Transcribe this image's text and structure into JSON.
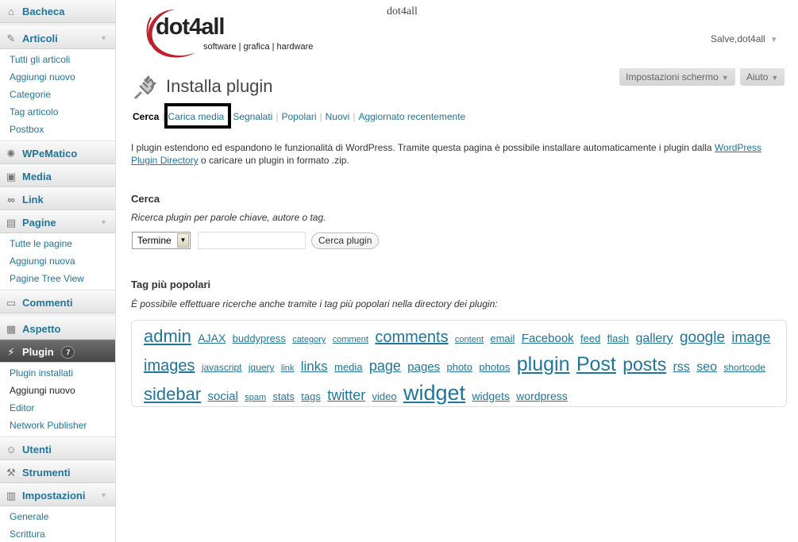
{
  "site": {
    "title": "dot4all",
    "logo_text": "dot4all",
    "logo_tagline": "software | grafica | hardware"
  },
  "header": {
    "howdy": "Salve,dot4all",
    "screen_options": "Impostazioni schermo",
    "help": "Aiuto"
  },
  "sidebar": {
    "dashboard": "Bacheca",
    "posts": {
      "label": "Articoli",
      "items": [
        "Tutti gli articoli",
        "Aggiungi nuovo",
        "Categorie",
        "Tag articolo",
        "Postbox"
      ]
    },
    "wpematico": "WPeMatico",
    "media": "Media",
    "links": "Link",
    "pages": {
      "label": "Pagine",
      "items": [
        "Tutte le pagine",
        "Aggiungi nuova",
        "Pagine Tree View"
      ]
    },
    "comments": "Commenti",
    "appearance": "Aspetto",
    "plugins": {
      "label": "Plugin",
      "badge": "7",
      "items": [
        "Plugin installati",
        "Aggiungi nuovo",
        "Editor",
        "Network Publisher"
      ]
    },
    "users": "Utenti",
    "tools": "Strumenti",
    "settings": {
      "label": "Impostazioni",
      "items": [
        "Generale",
        "Scrittura"
      ]
    }
  },
  "main": {
    "title": "Installa plugin",
    "subnav": [
      "Cerca",
      "Carica media",
      "Segnalati",
      "Popolari",
      "Nuovi",
      "Aggiornato recentemente"
    ],
    "intro_text": "I plugin estendono ed espandono le funzionalità di WordPress. Tramite questa pagina è possibile installare automaticamente i plugin dalla",
    "intro_link": "WordPress Plugin Directory",
    "intro_end": "o caricare un plugin in formato .zip.",
    "search": {
      "title": "Cerca",
      "desc": "Ricerca plugin per parole chiave, autore o tag.",
      "type_value": "Termine",
      "input_value": "",
      "button": "Cerca plugin"
    },
    "tags": {
      "title": "Tag più popolari",
      "desc": "È possibile effettuare ricerche anche tramite i tag più popolari nella directory dei plugin:",
      "items": [
        {
          "name": "admin",
          "size": 22
        },
        {
          "name": "AJAX",
          "size": 14
        },
        {
          "name": "buddypress",
          "size": 13
        },
        {
          "name": "category",
          "size": 11
        },
        {
          "name": "comment",
          "size": 11
        },
        {
          "name": "comments",
          "size": 20
        },
        {
          "name": "content",
          "size": 11
        },
        {
          "name": "email",
          "size": 13
        },
        {
          "name": "Facebook",
          "size": 15
        },
        {
          "name": "feed",
          "size": 13
        },
        {
          "name": "flash",
          "size": 13
        },
        {
          "name": "gallery",
          "size": 16
        },
        {
          "name": "google",
          "size": 19
        },
        {
          "name": "image",
          "size": 18
        },
        {
          "name": "images",
          "size": 20
        },
        {
          "name": "javascript",
          "size": 12
        },
        {
          "name": "jquery",
          "size": 12
        },
        {
          "name": "link",
          "size": 11
        },
        {
          "name": "links",
          "size": 17
        },
        {
          "name": "media",
          "size": 13
        },
        {
          "name": "page",
          "size": 18
        },
        {
          "name": "pages",
          "size": 15
        },
        {
          "name": "photo",
          "size": 13
        },
        {
          "name": "photos",
          "size": 13
        },
        {
          "name": "plugin",
          "size": 25
        },
        {
          "name": "Post",
          "size": 25
        },
        {
          "name": "posts",
          "size": 23
        },
        {
          "name": "rss",
          "size": 16
        },
        {
          "name": "seo",
          "size": 16
        },
        {
          "name": "shortcode",
          "size": 12
        },
        {
          "name": "sidebar",
          "size": 22
        },
        {
          "name": "social",
          "size": 15
        },
        {
          "name": "spam",
          "size": 11
        },
        {
          "name": "stats",
          "size": 13
        },
        {
          "name": "tags",
          "size": 13
        },
        {
          "name": "twitter",
          "size": 18
        },
        {
          "name": "video",
          "size": 13
        },
        {
          "name": "widget",
          "size": 27
        },
        {
          "name": "widgets",
          "size": 14
        },
        {
          "name": "wordpress",
          "size": 14
        }
      ]
    }
  }
}
